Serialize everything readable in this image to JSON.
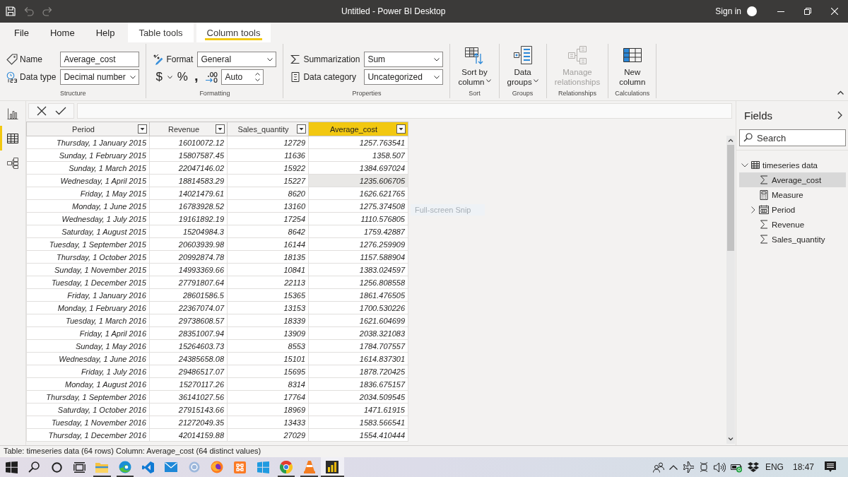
{
  "window": {
    "title": "Untitled - Power BI Desktop",
    "sign_in": "Sign in",
    "quick_access": [
      {
        "disabled": false
      },
      {
        "disabled": true
      },
      {
        "disabled": true
      }
    ]
  },
  "menu_tabs": [
    {
      "label": "File",
      "contextual": false,
      "selected": false
    },
    {
      "label": "Home",
      "contextual": false,
      "selected": false
    },
    {
      "label": "Help",
      "contextual": false,
      "selected": false
    },
    {
      "label": "Table tools",
      "contextual": true,
      "selected": false
    },
    {
      "label": "Column tools",
      "contextual": true,
      "selected": true
    }
  ],
  "ribbon": {
    "groups": [
      {
        "kind": "fields",
        "label": "Structure",
        "fields": [
          {
            "kind": "text",
            "label": "Name",
            "value": "Average_cost"
          },
          {
            "kind": "select",
            "label": "Data type",
            "value": "Decimal number"
          }
        ]
      },
      {
        "kind": "formatting",
        "label": "Formatting",
        "fields": [
          {
            "kind": "select",
            "label": "Format",
            "value": "General"
          }
        ],
        "symbols": [
          {
            "text": "$",
            "dropdown": true
          },
          {
            "text": "%",
            "dropdown": false
          },
          {
            "text": ",",
            "dropdown": false
          }
        ],
        "decimal_places": "Auto"
      },
      {
        "kind": "fields",
        "label": "Properties",
        "fields": [
          {
            "kind": "select",
            "label": "Summarization",
            "value": "Sum"
          },
          {
            "kind": "select",
            "label": "Data category",
            "value": "Uncategorized"
          }
        ]
      },
      {
        "kind": "buttons",
        "label": "Sort",
        "buttons": [
          {
            "lines": [
              "Sort by",
              "column"
            ],
            "dropdown": true,
            "disabled": false
          }
        ]
      },
      {
        "kind": "buttons",
        "label": "Groups",
        "buttons": [
          {
            "lines": [
              "Data",
              "groups"
            ],
            "dropdown": true,
            "disabled": false
          }
        ]
      },
      {
        "kind": "buttons",
        "label": "Relationships",
        "buttons": [
          {
            "lines": [
              "Manage",
              "relationships"
            ],
            "dropdown": false,
            "disabled": true
          }
        ]
      },
      {
        "kind": "buttons",
        "label": "Calculations",
        "buttons": [
          {
            "lines": [
              "New",
              "column"
            ],
            "dropdown": false,
            "disabled": false
          }
        ]
      }
    ]
  },
  "views": [
    {
      "selected": false
    },
    {
      "selected": true
    },
    {
      "selected": false
    }
  ],
  "table": {
    "columns": [
      {
        "label": "Period",
        "selected": false
      },
      {
        "label": "Revenue",
        "selected": false
      },
      {
        "label": "Sales_quantity",
        "selected": false
      },
      {
        "label": "Average_cost",
        "selected": true
      }
    ],
    "rows": [
      {
        "cells": [
          "Thursday, 1 January 2015",
          "16010072.12",
          "12729",
          "1257.763541"
        ],
        "selected": false
      },
      {
        "cells": [
          "Sunday, 1 February 2015",
          "15807587.45",
          "11636",
          "1358.507"
        ],
        "selected": false
      },
      {
        "cells": [
          "Sunday, 1 March 2015",
          "22047146.02",
          "15922",
          "1384.697024"
        ],
        "selected": false
      },
      {
        "cells": [
          "Wednesday, 1 April 2015",
          "18814583.29",
          "15227",
          "1235.606705"
        ],
        "selected": true
      },
      {
        "cells": [
          "Friday, 1 May 2015",
          "14021479.61",
          "8620",
          "1626.621765"
        ],
        "selected": false
      },
      {
        "cells": [
          "Monday, 1 June 2015",
          "16783928.52",
          "13160",
          "1275.374508"
        ],
        "selected": false
      },
      {
        "cells": [
          "Wednesday, 1 July 2015",
          "19161892.19",
          "17254",
          "1110.576805"
        ],
        "selected": false
      },
      {
        "cells": [
          "Saturday, 1 August 2015",
          "15204984.3",
          "8642",
          "1759.42887"
        ],
        "selected": false
      },
      {
        "cells": [
          "Tuesday, 1 September 2015",
          "20603939.98",
          "16144",
          "1276.259909"
        ],
        "selected": false
      },
      {
        "cells": [
          "Thursday, 1 October 2015",
          "20992874.78",
          "18135",
          "1157.588904"
        ],
        "selected": false
      },
      {
        "cells": [
          "Sunday, 1 November 2015",
          "14993369.66",
          "10841",
          "1383.024597"
        ],
        "selected": false
      },
      {
        "cells": [
          "Tuesday, 1 December 2015",
          "27791807.64",
          "22113",
          "1256.808558"
        ],
        "selected": false
      },
      {
        "cells": [
          "Friday, 1 January 2016",
          "28601586.5",
          "15365",
          "1861.476505"
        ],
        "selected": false
      },
      {
        "cells": [
          "Monday, 1 February 2016",
          "22367074.07",
          "13153",
          "1700.530226"
        ],
        "selected": false
      },
      {
        "cells": [
          "Tuesday, 1 March 2016",
          "29738608.57",
          "18339",
          "1621.604699"
        ],
        "selected": false
      },
      {
        "cells": [
          "Friday, 1 April 2016",
          "28351007.94",
          "13909",
          "2038.321083"
        ],
        "selected": false
      },
      {
        "cells": [
          "Sunday, 1 May 2016",
          "15264603.73",
          "8553",
          "1784.707557"
        ],
        "selected": false
      },
      {
        "cells": [
          "Wednesday, 1 June 2016",
          "24385658.08",
          "15101",
          "1614.837301"
        ],
        "selected": false
      },
      {
        "cells": [
          "Friday, 1 July 2016",
          "29486517.07",
          "15695",
          "1878.720425"
        ],
        "selected": false
      },
      {
        "cells": [
          "Monday, 1 August 2016",
          "15270117.26",
          "8314",
          "1836.675157"
        ],
        "selected": false
      },
      {
        "cells": [
          "Thursday, 1 September 2016",
          "36141027.56",
          "17764",
          "2034.509545"
        ],
        "selected": false
      },
      {
        "cells": [
          "Saturday, 1 October 2016",
          "27915143.66",
          "18969",
          "1471.61915"
        ],
        "selected": false
      },
      {
        "cells": [
          "Tuesday, 1 November 2016",
          "21272049.35",
          "13433",
          "1583.566541"
        ],
        "selected": false
      },
      {
        "cells": [
          "Thursday, 1 December 2016",
          "42014159.88",
          "27029",
          "1554.410444"
        ],
        "selected": false
      }
    ]
  },
  "snip_tooltip": {
    "text": "Full-screen Snip"
  },
  "fields_pane": {
    "title": "Fields",
    "search": {
      "placeholder": "Search"
    },
    "tables": [
      {
        "name": "timeseries data",
        "expanded": true,
        "children": [
          {
            "name": "Average_cost",
            "kind": "sum",
            "selected": true
          },
          {
            "name": "Measure",
            "kind": "measure",
            "selected": false
          },
          {
            "name": "Period",
            "kind": "date",
            "selected": false,
            "expanded": false
          },
          {
            "name": "Revenue",
            "kind": "sum",
            "selected": false
          },
          {
            "name": "Sales_quantity",
            "kind": "sum",
            "selected": false
          }
        ]
      }
    ]
  },
  "status_bar": {
    "text": "Table: timeseries data (64 rows) Column: Average_cost (64 distinct values)"
  },
  "taskbar": {
    "apps": [
      {
        "running": true,
        "selected": false
      },
      {
        "running": true,
        "selected": false
      },
      {
        "running": false,
        "selected": false
      },
      {
        "running": false,
        "selected": false
      },
      {
        "running": false,
        "selected": false
      },
      {
        "running": false,
        "selected": false
      },
      {
        "running": false,
        "selected": false
      },
      {
        "running": false,
        "selected": false
      },
      {
        "running": true,
        "selected": false
      },
      {
        "running": true,
        "selected": false
      },
      {
        "running": true,
        "selected": true
      }
    ],
    "tray": {
      "language": "ENG",
      "time": "18:47"
    }
  }
}
